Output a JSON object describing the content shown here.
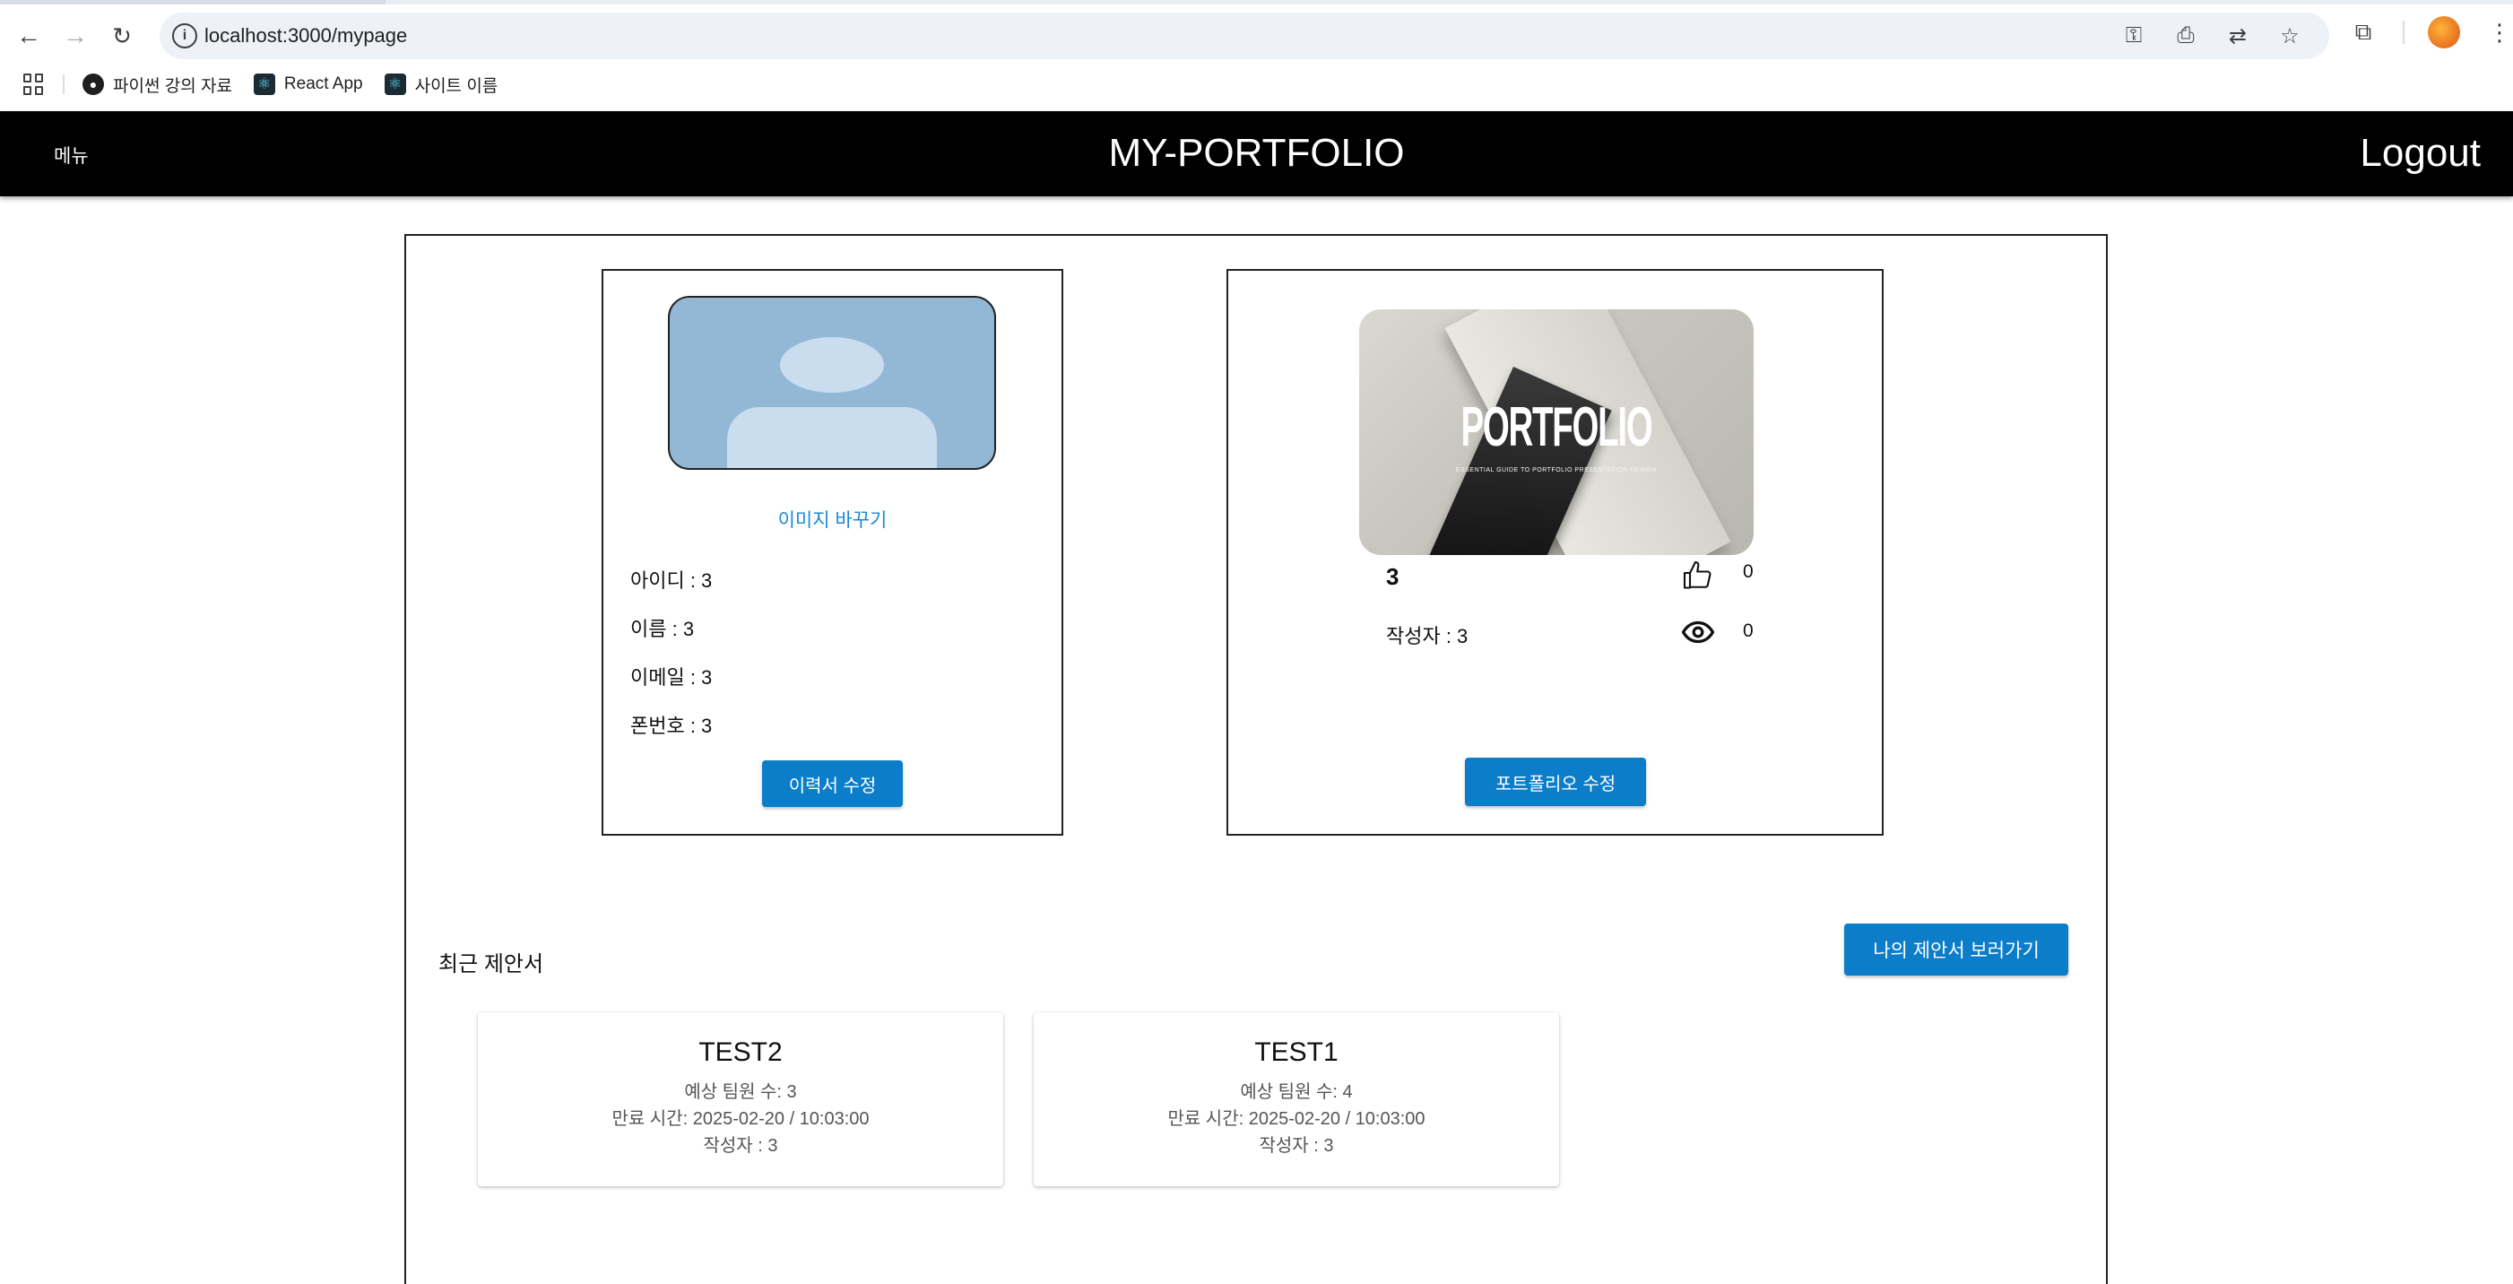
{
  "browser": {
    "url": "localhost:3000/mypage",
    "bookmarks": [
      {
        "label": "파이썬 강의 자료",
        "icon": "github-icon"
      },
      {
        "label": "React App",
        "icon": "react-icon"
      },
      {
        "label": "사이트 이름",
        "icon": "react-icon"
      }
    ]
  },
  "header": {
    "menu_label": "메뉴",
    "title": "MY-PORTFOLIO",
    "logout_label": "Logout"
  },
  "profile": {
    "change_image_label": "이미지 바꾸기",
    "id_line": "아이디 : 3",
    "name_line": "이름 : 3",
    "email_line": "이메일 : 3",
    "phone_line": "폰번호 : 3",
    "edit_resume_label": "이력서 수정"
  },
  "portfolio": {
    "cover_title": "PORTFOLIO",
    "cover_subtitle": "ESSENTIAL GUIDE TO PORTFOLIO PRESENTATION DESIGN",
    "number": "3",
    "author_line": "작성자 : 3",
    "like_count": "0",
    "view_count": "0",
    "edit_portfolio_label": "포트폴리오 수정"
  },
  "recent": {
    "section_title": "최근 제안서",
    "view_all_label": "나의 제안서 보러가기",
    "proposals": [
      {
        "title": "TEST2",
        "team_line": "예상 팀원 수: 3",
        "expire_line": "만료 시간: 2025-02-20 / 10:03:00",
        "author_line": "작성자 : 3"
      },
      {
        "title": "TEST1",
        "team_line": "예상 팀원 수: 4",
        "expire_line": "만료 시간: 2025-02-20 / 10:03:00",
        "author_line": "작성자 : 3"
      }
    ]
  },
  "colors": {
    "header_bg": "#000000",
    "primary_button": "#0b7dc9",
    "link": "#1a8ad4"
  }
}
